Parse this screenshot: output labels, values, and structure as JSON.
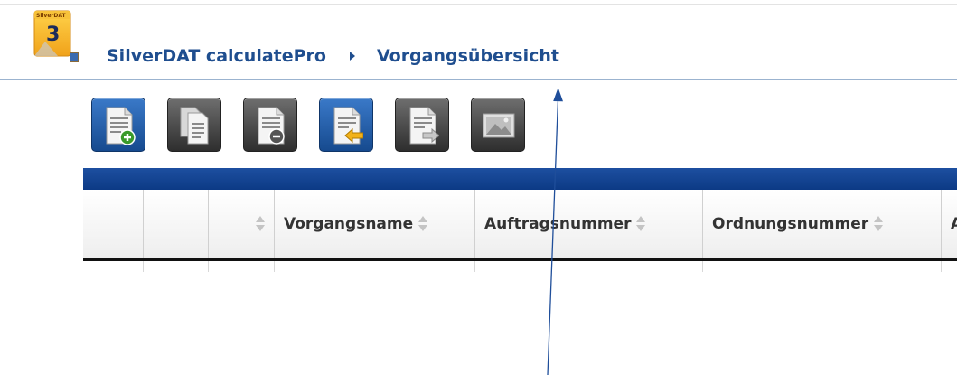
{
  "header": {
    "logo_text": "SilverDAT",
    "logo_number": "3",
    "breadcrumb": [
      "SilverDAT calculatePro",
      "Vorgangsübersicht"
    ]
  },
  "toolbar": {
    "buttons": [
      {
        "icon": "document-add-icon",
        "style": "blue"
      },
      {
        "icon": "document-copy-icon",
        "style": "dark"
      },
      {
        "icon": "document-remove-icon",
        "style": "dark"
      },
      {
        "icon": "document-import-icon",
        "style": "blue"
      },
      {
        "icon": "document-export-icon",
        "style": "dark"
      },
      {
        "icon": "image-icon",
        "style": "dark"
      }
    ]
  },
  "grid": {
    "columns": [
      "",
      "",
      "",
      "Vorgangsname",
      "Auftragsnummer",
      "Ordnungsnummer",
      "A"
    ]
  },
  "colors": {
    "brand_blue": "#1f4e8f",
    "grid_band": "#0c3a85",
    "annotation_arrow": "#1f4e9a"
  }
}
